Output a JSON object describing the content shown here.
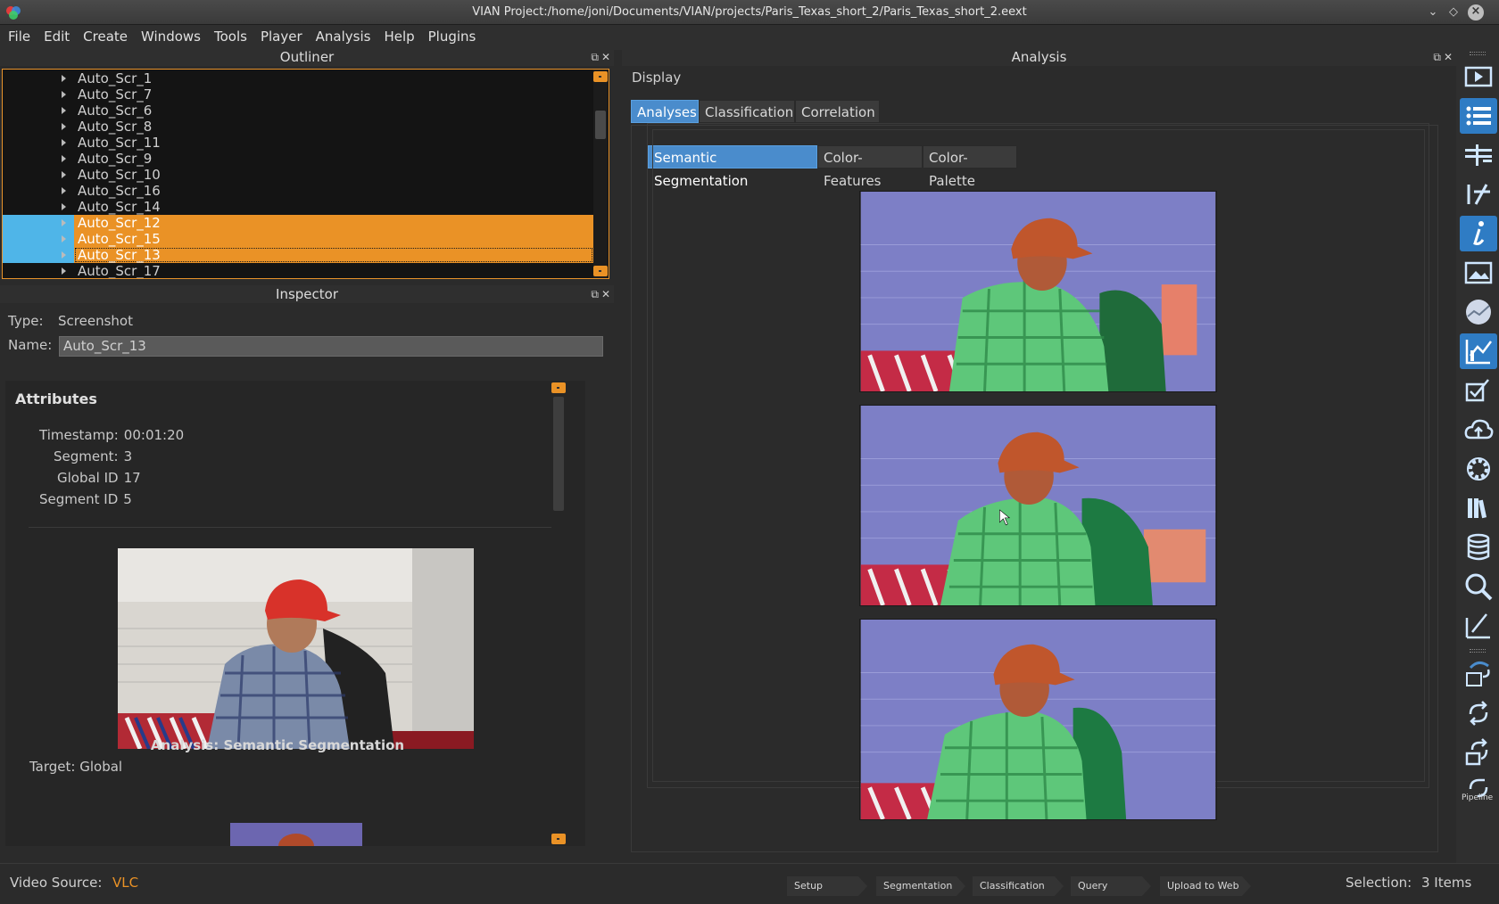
{
  "window": {
    "title": "VIAN Project:/home/joni/Documents/VIAN/projects/Paris_Texas_short_2/Paris_Texas_short_2.eext"
  },
  "menu": [
    "File",
    "Edit",
    "Create",
    "Windows",
    "Tools",
    "Player",
    "Analysis",
    "Help",
    "Plugins"
  ],
  "outliner": {
    "title": "Outliner",
    "items": [
      {
        "label": "Auto_Scr_1"
      },
      {
        "label": "Auto_Scr_7"
      },
      {
        "label": "Auto_Scr_6"
      },
      {
        "label": "Auto_Scr_8"
      },
      {
        "label": "Auto_Scr_11"
      },
      {
        "label": "Auto_Scr_9"
      },
      {
        "label": "Auto_Scr_10"
      },
      {
        "label": "Auto_Scr_16"
      },
      {
        "label": "Auto_Scr_14"
      },
      {
        "label": "Auto_Scr_12",
        "selected": true
      },
      {
        "label": "Auto_Scr_15",
        "selected": true
      },
      {
        "label": "Auto_Scr_13",
        "selected": true,
        "current": true
      },
      {
        "label": "Auto_Scr_17"
      }
    ]
  },
  "inspector": {
    "title": "Inspector",
    "type_label": "Type:",
    "type_value": "Screenshot",
    "name_label": "Name:",
    "name_value": "Auto_Scr_13",
    "attributes_heading": "Attributes",
    "attributes": {
      "timestamp_key": "Timestamp:",
      "timestamp_val": "00:01:20",
      "segment_key": "Segment:",
      "segment_val": "3",
      "global_id_key": "Global ID",
      "global_id_val": "17",
      "segment_id_key": "Segment ID",
      "segment_id_val": "5"
    },
    "analysis_heading": "Analysis: Semantic Segmentation",
    "target_label": "Target: Global"
  },
  "analysis": {
    "title": "Analysis",
    "display_label": "Display",
    "tabs": [
      "Analyses",
      "Classification",
      "Correlation"
    ],
    "active_tab": "Analyses",
    "subtabs": [
      "Semantic Segmentation",
      "Color-Features",
      "Color-Palette"
    ],
    "active_subtab": "Semantic Segmentation"
  },
  "toolbar_icons": [
    "player-icon",
    "outliner-icon",
    "timeline-icon",
    "screenshot-manager-icon",
    "inspector-icon",
    "image-icon",
    "color-icon",
    "analysis-chart-icon",
    "classification-check-icon",
    "cloud-upload-icon",
    "settings-gear-icon",
    "library-icon",
    "database-icon",
    "search-icon",
    "brush-icon",
    "screenshot-refresh-icon",
    "refresh-icon",
    "screenshot-sync-icon",
    "pipeline-icon"
  ],
  "toolbar_pipeline_label": "Pipeline",
  "status": {
    "video_source_label": "Video Source:",
    "video_source_value": "VLC",
    "pipeline_steps": [
      "Setup",
      "Segmentation",
      "Classification",
      "Query",
      "Upload to Web"
    ],
    "selection_label": "Selection:",
    "selection_value": "3 Items"
  },
  "colors": {
    "accent_orange": "#ea9226",
    "accent_blue": "#4fb5e8",
    "tab_active": "#4a8ccc",
    "vlc_orange": "#ea9226"
  }
}
